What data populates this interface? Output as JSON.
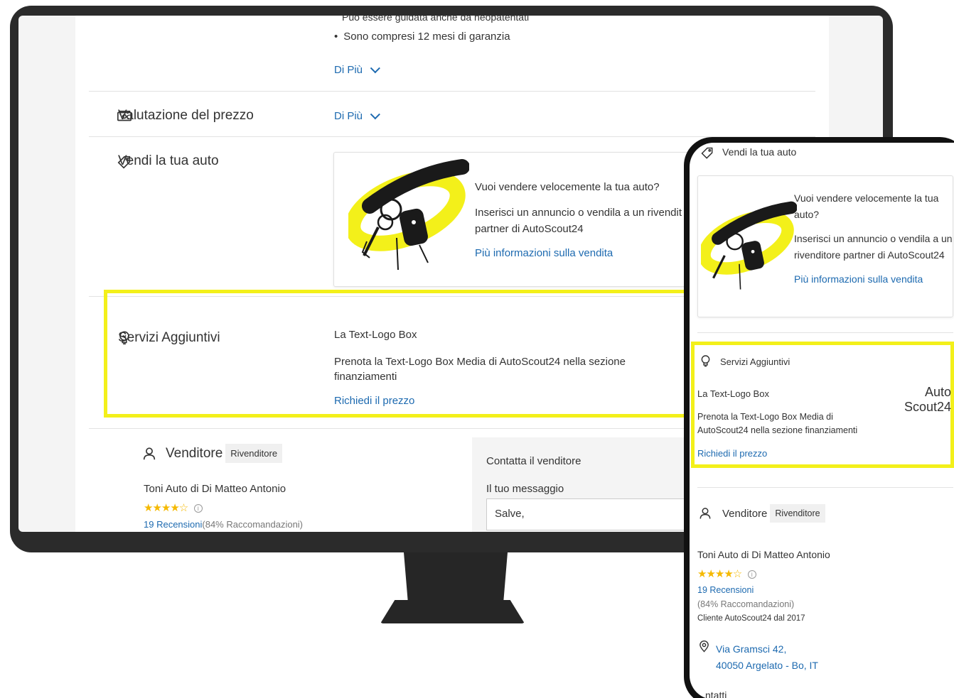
{
  "desktop": {
    "top_bullet_cut": "Può essere guidata anche da neopatentati",
    "bullet": "Sono compresi 12 mesi di garanzia",
    "more_label_1": "Di Più",
    "price_section_title": "Valutazione del prezzo",
    "more_label_2": "Di Più",
    "sell_section_title": "Vendi la tua auto",
    "sell_question": "Vuoi vendere velocemente la tua auto?",
    "sell_desc_1": "Inserisci un annuncio o vendila a un rivendit",
    "sell_desc_2": "partner di AutoScout24",
    "sell_link": "Più informazioni sulla vendita",
    "services_title": "Servizi Aggiuntivi",
    "services_sub": "La Text-Logo Box",
    "services_desc": "Prenota la Text-Logo Box Media di AutoScout24 nella sezione finanziamenti",
    "services_link": "Richiedi il prezzo",
    "seller_title": "Venditore",
    "seller_badge": "Rivenditore",
    "dealer_name": "Toni Auto di Di Matteo Antonio",
    "stars": "★★★★☆",
    "reviews_link": "19 Recensioni",
    "recommendations": "(84% Raccomandazioni)",
    "contact_title": "Contatta il venditore",
    "message_label": "Il tuo messaggio",
    "message_value": "Salve,"
  },
  "mobile": {
    "sell_title": "Vendi la tua auto",
    "sell_question": "Vuoi vendere velocemente la tua auto?",
    "sell_desc": "Inserisci un annuncio o vendila a un rivenditore partner di AutoScout24",
    "sell_link": "Più informazioni sulla vendita",
    "services_title": "Servizi Aggiuntivi",
    "services_sub": "La Text-Logo Box",
    "services_desc": "Prenota la Text-Logo Box Media di AutoScout24 nella sezione finanziamenti",
    "services_link": "Richiedi il prezzo",
    "logo_line1": "Auto",
    "logo_line2": "Scout24",
    "seller_title": "Venditore",
    "seller_badge": "Rivenditore",
    "dealer_name": "Toni Auto di Di Matteo Antonio",
    "stars": "★★★★☆",
    "reviews_link": "19 Recensioni",
    "recommendations": "(84% Raccomandazioni)",
    "customer_since": "Cliente AutoScout24 dal 2017",
    "address_line1": "Via Gramsci 42,",
    "address_line2": "40050 Argelato - Bo, IT",
    "contacts_cut": "ntatti"
  },
  "colors": {
    "highlight": "#f3f01a",
    "link": "#1d6ab0",
    "star": "#f5b900"
  }
}
